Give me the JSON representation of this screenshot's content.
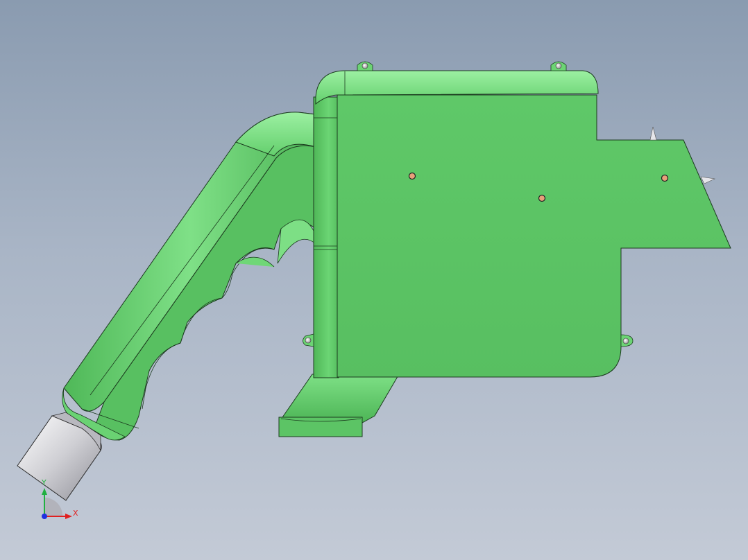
{
  "viewport": {
    "background_top": "#8a9bb0",
    "background_bottom": "#c3cad6"
  },
  "model": {
    "body_color": "#5cc465",
    "body_highlight": "#86e58c",
    "body_shadow": "#3e9a47",
    "edge_color": "#1b3a1e",
    "nozzle_color": "#d8d8dc",
    "screw_color": "#e8a07a"
  },
  "triad": {
    "x_label": "X",
    "y_label": "Y",
    "x_color": "#e02020",
    "y_color": "#20b040",
    "z_color": "#2030e0"
  }
}
